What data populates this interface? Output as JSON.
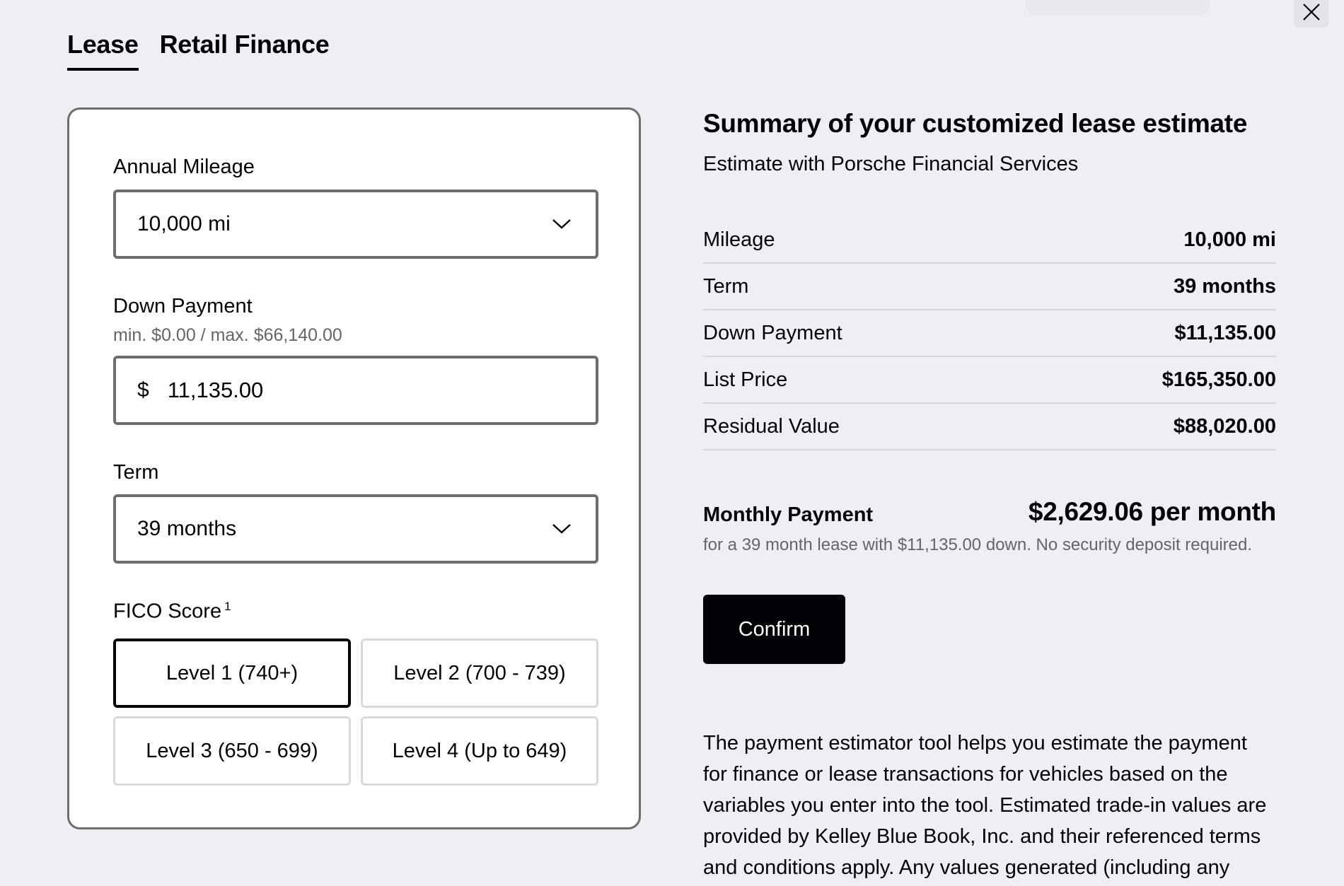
{
  "tabs": [
    {
      "label": "Lease",
      "active": true
    },
    {
      "label": "Retail Finance",
      "active": false
    }
  ],
  "form": {
    "mileage": {
      "label": "Annual Mileage",
      "value": "10,000 mi"
    },
    "down_payment": {
      "label": "Down Payment",
      "hint": "min. $0.00 / max. $66,140.00",
      "prefix": "$",
      "value": "11,135.00"
    },
    "term": {
      "label": "Term",
      "value": "39 months"
    },
    "fico": {
      "label": "FICO Score",
      "footnote": "1",
      "options": [
        {
          "label": "Level 1 (740+)",
          "selected": true
        },
        {
          "label": "Level 2 (700 - 739)",
          "selected": false
        },
        {
          "label": "Level 3 (650 - 699)",
          "selected": false
        },
        {
          "label": "Level 4 (Up to 649)",
          "selected": false
        }
      ]
    }
  },
  "summary": {
    "title": "Summary of your customized lease estimate",
    "subtitle": "Estimate with Porsche Financial Services",
    "rows": [
      {
        "label": "Mileage",
        "value": "10,000 mi"
      },
      {
        "label": "Term",
        "value": "39 months"
      },
      {
        "label": "Down Payment",
        "value": "$11,135.00"
      },
      {
        "label": "List Price",
        "value": "$165,350.00"
      },
      {
        "label": "Residual Value",
        "value": "$88,020.00"
      }
    ],
    "monthly_label": "Monthly Payment",
    "monthly_value": "$2,629.06 per month",
    "monthly_note": "for a 39 month lease with $11,135.00 down. No security deposit required.",
    "confirm_label": "Confirm",
    "disclaimer": "The payment estimator tool helps you estimate the payment for finance or lease transactions for vehicles based on the variables you enter into the tool. Estimated trade-in values are provided by Kelley Blue Book, Inc. and their referenced terms and conditions apply. Any values generated (including any trade-in values, taxes,"
  },
  "icons": {
    "close": "close-icon",
    "chevron": "chevron-down-icon"
  },
  "colors": {
    "background": "#eeeff2",
    "text": "#010205",
    "border": "#6b6d70",
    "button": "#010205"
  }
}
